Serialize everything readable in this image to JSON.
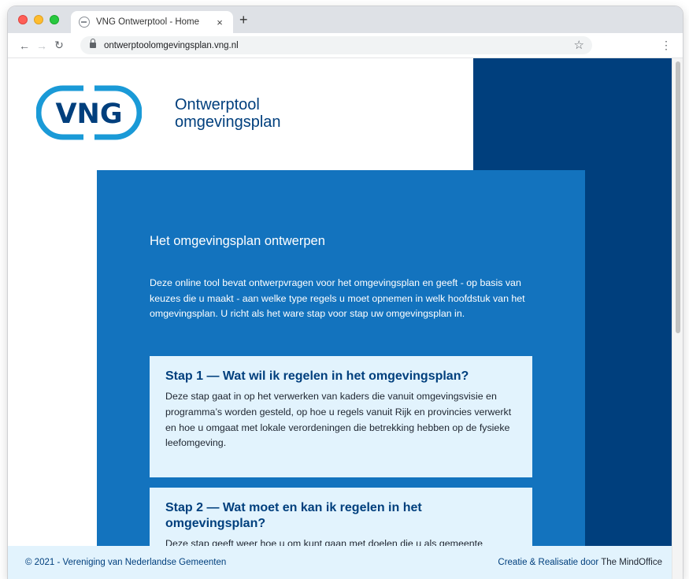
{
  "browser": {
    "tab_title": "VNG Ontwerptool - Home",
    "tab_close": "×",
    "new_tab": "+",
    "url": "ontwerptoolomgevingsplan.vng.nl",
    "back": "←",
    "forward": "→",
    "reload": "↻",
    "bookmark": "☆",
    "menu": "⋮"
  },
  "header": {
    "logo_text": "VNG",
    "site_name_line1": "Ontwerptool",
    "site_name_line2": "omgevingsplan"
  },
  "hero": {
    "title": "Het omgevingsplan ontwerpen",
    "intro": "Deze online tool bevat ontwerpvragen voor het omgevingsplan en geeft - op basis van keuzes die u maakt - aan welke type regels u moet opnemen in welk hoofdstuk van het omgevingsplan. U richt als het ware stap voor stap uw omgevingsplan in."
  },
  "steps": [
    {
      "title": "Stap 1 — Wat wil ik regelen in het omgevingsplan?",
      "body": "Deze stap gaat in op het verwerken van kaders die vanuit omgevingsvisie en programma’s worden gesteld, op hoe u regels vanuit Rijk en provincies verwerkt en hoe u omgaat met lokale verordeningen die betrekking hebben op de fysieke leefomgeving."
    },
    {
      "title": "Stap 2 — Wat moet en kan ik regelen in het omgevingsplan?",
      "body": "Deze stap geeft weer hoe u om kunt gaan met doelen die u als gemeente"
    }
  ],
  "footer": {
    "copyright": "© 2021 - Vereniging van Nederlandse Gemeenten",
    "credit_prefix": "Creatie & Realisatie door",
    "credit_maker": "The MindOffice"
  },
  "colors": {
    "brand_dark": "#003f7d",
    "brand_blue": "#1373be",
    "card_bg": "#e2f3fd",
    "logo_light": "#1a9ad7"
  }
}
